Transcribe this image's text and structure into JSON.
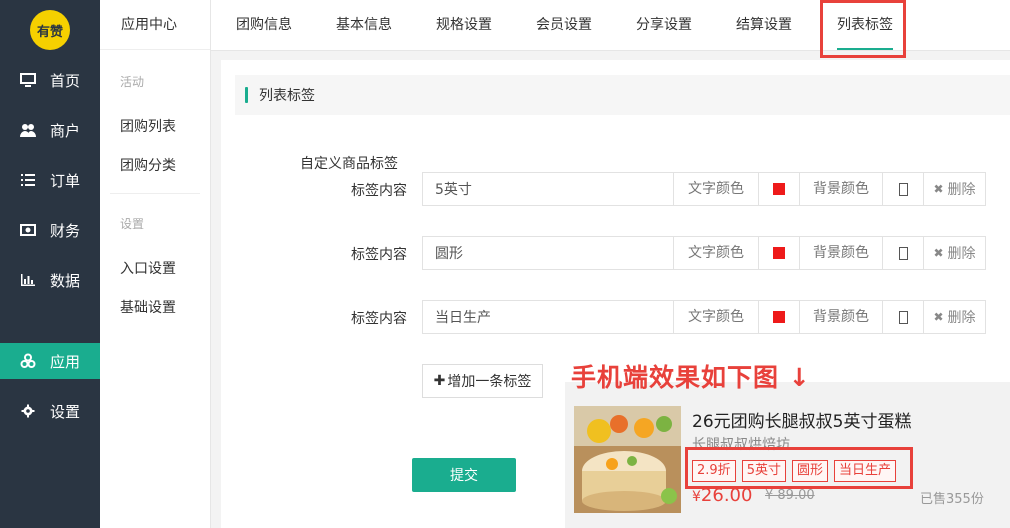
{
  "logo": {
    "text": "有赞"
  },
  "nav": [
    {
      "icon": "monitor-icon",
      "label": "首页"
    },
    {
      "icon": "users-icon",
      "label": "商户"
    },
    {
      "icon": "list-icon",
      "label": "订单"
    },
    {
      "icon": "money-icon",
      "label": "财务"
    },
    {
      "icon": "bar-chart-icon",
      "label": "数据"
    },
    {
      "icon": "apps-icon",
      "label": "应用"
    },
    {
      "icon": "gear-icon",
      "label": "设置"
    }
  ],
  "subnav": {
    "header": "应用中心",
    "section_activity": "活动",
    "groupbuy_list": "团购列表",
    "groupbuy_category": "团购分类",
    "section_settings": "设置",
    "entry_settings": "入口设置",
    "basic_settings": "基础设置"
  },
  "tabs": [
    "团购信息",
    "基本信息",
    "规格设置",
    "会员设置",
    "分享设置",
    "结算设置",
    "列表标签"
  ],
  "section_title": "列表标签",
  "form": {
    "title": "自定义商品标签",
    "row_label": "标签内容",
    "text_color_label": "文字颜色",
    "bg_color_label": "背景颜色",
    "delete_label": "删除",
    "rows": [
      {
        "value": "5英寸"
      },
      {
        "value": "圆形"
      },
      {
        "value": "当日生产"
      }
    ],
    "add_button": "增加一条标签",
    "submit_button": "提交"
  },
  "colors": {
    "accent": "#1aad8f",
    "tag_text": "#ee1a1a",
    "annotation": "#e8413b"
  },
  "preview": {
    "note": "手机端效果如下图 ↓",
    "product_name": "26元团购长腿叔叔5英寸蛋糕",
    "shop_name": "长腿叔叔烘焙坊",
    "tags": [
      "2.9折",
      "5英寸",
      "圆形",
      "当日生产"
    ],
    "price_symbol": "¥",
    "price": "26.00",
    "original_price": "¥ 89.00",
    "sold": "已售355份"
  }
}
